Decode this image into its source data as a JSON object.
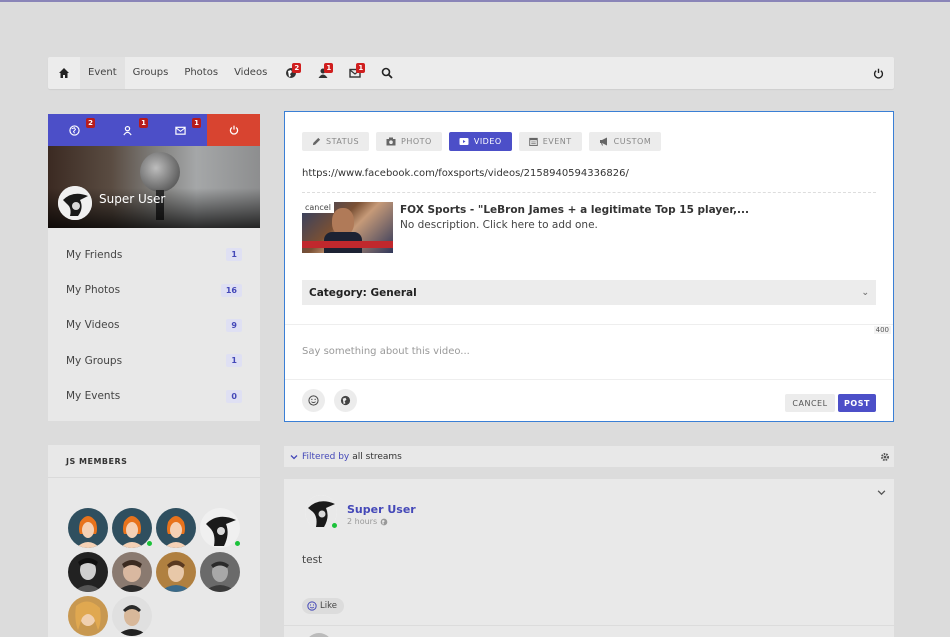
{
  "topnav": {
    "items": [
      "Event",
      "Groups",
      "Photos",
      "Videos"
    ],
    "badges": {
      "globe": "2",
      "friends": "1",
      "inbox": "1"
    }
  },
  "sidebar": {
    "badges": {
      "globe": "2",
      "friends": "1",
      "inbox": "1"
    },
    "username": "Super User",
    "items": [
      {
        "label": "My Friends",
        "count": "1"
      },
      {
        "label": "My Photos",
        "count": "16"
      },
      {
        "label": "My Videos",
        "count": "9"
      },
      {
        "label": "My Groups",
        "count": "1"
      },
      {
        "label": "My Events",
        "count": "0"
      }
    ]
  },
  "composer": {
    "tabs": [
      "STATUS",
      "PHOTO",
      "VIDEO",
      "EVENT",
      "CUSTOM"
    ],
    "active_tab": "VIDEO",
    "url": "https://www.facebook.com/foxsports/videos/2158940594336826/",
    "preview": {
      "cancel": "cancel",
      "title": "FOX Sports - \"LeBron James + a legitimate Top 15 player,...",
      "description": "No description. Click here to add one."
    },
    "category": "Category: General",
    "char_count": "400",
    "placeholder": "Say something about this video...",
    "cancel_label": "CANCEL",
    "post_label": "POST"
  },
  "members": {
    "title": "JS MEMBERS"
  },
  "stream": {
    "filtered_by": "Filtered by",
    "filter_value": "all streams"
  },
  "post": {
    "author": "Super User",
    "time": "2 hours",
    "text": "test",
    "like_label": "Like"
  },
  "colors": {
    "accent": "#4c4fc8",
    "danger": "#d84430",
    "badge": "#d01e1e",
    "online": "#1bc23a"
  }
}
